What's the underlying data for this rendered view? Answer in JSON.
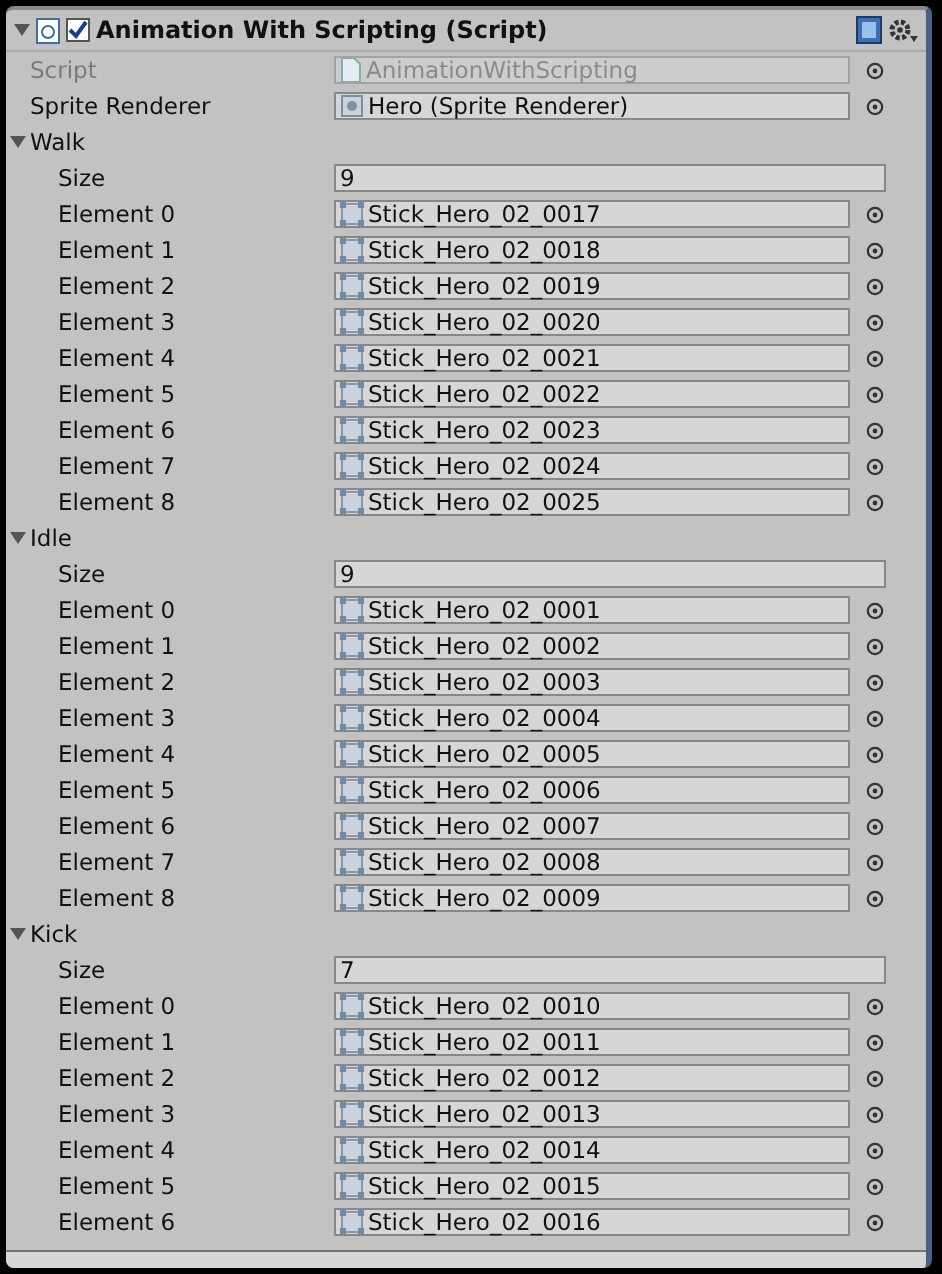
{
  "component": {
    "title": "Animation With Scripting (Script)",
    "enabled": true,
    "expanded": true
  },
  "fields": [
    {
      "label": "Script",
      "value": "AnimationWithScripting",
      "disabled": true,
      "kind": "script"
    },
    {
      "label": "Sprite Renderer",
      "value": "Hero (Sprite Renderer)",
      "disabled": false,
      "kind": "renderer"
    }
  ],
  "arrays": [
    {
      "label": "Walk",
      "expanded": true,
      "size_label": "Size",
      "size": "9",
      "elements": [
        {
          "label": "Element 0",
          "value": "Stick_Hero_02_0017"
        },
        {
          "label": "Element 1",
          "value": "Stick_Hero_02_0018"
        },
        {
          "label": "Element 2",
          "value": "Stick_Hero_02_0019"
        },
        {
          "label": "Element 3",
          "value": "Stick_Hero_02_0020"
        },
        {
          "label": "Element 4",
          "value": "Stick_Hero_02_0021"
        },
        {
          "label": "Element 5",
          "value": "Stick_Hero_02_0022"
        },
        {
          "label": "Element 6",
          "value": "Stick_Hero_02_0023"
        },
        {
          "label": "Element 7",
          "value": "Stick_Hero_02_0024"
        },
        {
          "label": "Element 8",
          "value": "Stick_Hero_02_0025"
        }
      ]
    },
    {
      "label": "Idle",
      "expanded": true,
      "size_label": "Size",
      "size": "9",
      "elements": [
        {
          "label": "Element 0",
          "value": "Stick_Hero_02_0001"
        },
        {
          "label": "Element 1",
          "value": "Stick_Hero_02_0002"
        },
        {
          "label": "Element 2",
          "value": "Stick_Hero_02_0003"
        },
        {
          "label": "Element 3",
          "value": "Stick_Hero_02_0004"
        },
        {
          "label": "Element 4",
          "value": "Stick_Hero_02_0005"
        },
        {
          "label": "Element 5",
          "value": "Stick_Hero_02_0006"
        },
        {
          "label": "Element 6",
          "value": "Stick_Hero_02_0007"
        },
        {
          "label": "Element 7",
          "value": "Stick_Hero_02_0008"
        },
        {
          "label": "Element 8",
          "value": "Stick_Hero_02_0009"
        }
      ]
    },
    {
      "label": "Kick",
      "expanded": true,
      "size_label": "Size",
      "size": "7",
      "elements": [
        {
          "label": "Element 0",
          "value": "Stick_Hero_02_0010"
        },
        {
          "label": "Element 1",
          "value": "Stick_Hero_02_0011"
        },
        {
          "label": "Element 2",
          "value": "Stick_Hero_02_0012"
        },
        {
          "label": "Element 3",
          "value": "Stick_Hero_02_0013"
        },
        {
          "label": "Element 4",
          "value": "Stick_Hero_02_0014"
        },
        {
          "label": "Element 5",
          "value": "Stick_Hero_02_0015"
        },
        {
          "label": "Element 6",
          "value": "Stick_Hero_02_0016"
        }
      ]
    }
  ]
}
